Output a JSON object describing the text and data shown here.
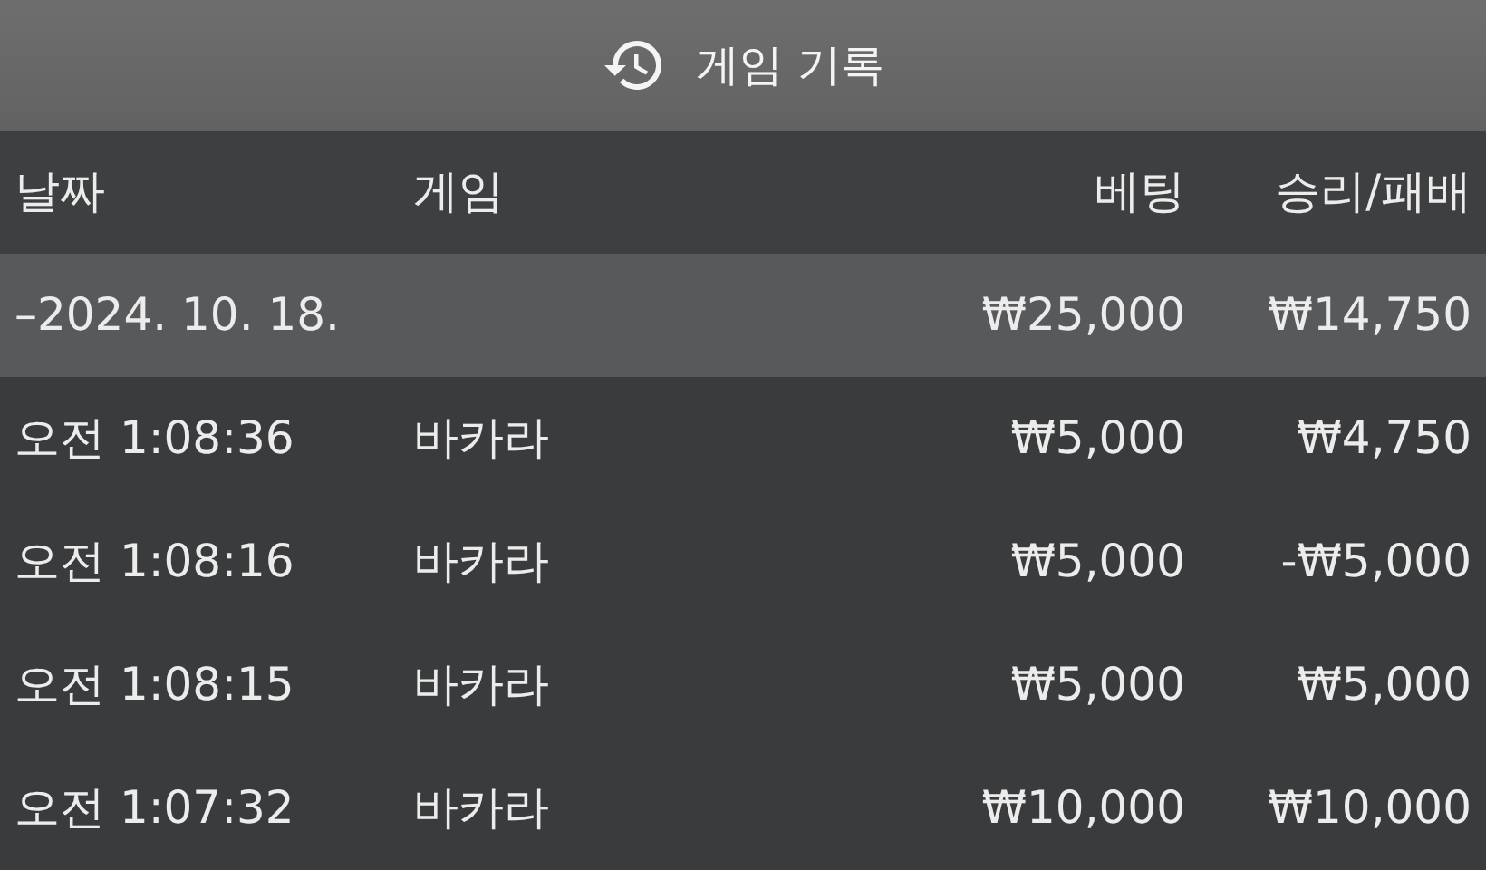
{
  "title": "게임 기록",
  "columns": [
    "날짜",
    "게임",
    "베팅",
    "승리/패배"
  ],
  "group": {
    "date": "–2024. 10. 18.",
    "bet": "₩25,000",
    "result": "₩14,750"
  },
  "rows": [
    {
      "time": "오전 1:08:36",
      "game": "바카라",
      "bet": "₩5,000",
      "result": "₩4,750"
    },
    {
      "time": "오전 1:08:16",
      "game": "바카라",
      "bet": "₩5,000",
      "result": "-₩5,000"
    },
    {
      "time": "오전 1:08:15",
      "game": "바카라",
      "bet": "₩5,000",
      "result": "₩5,000"
    },
    {
      "time": "오전 1:07:32",
      "game": "바카라",
      "bet": "₩10,000",
      "result": "₩10,000"
    }
  ]
}
